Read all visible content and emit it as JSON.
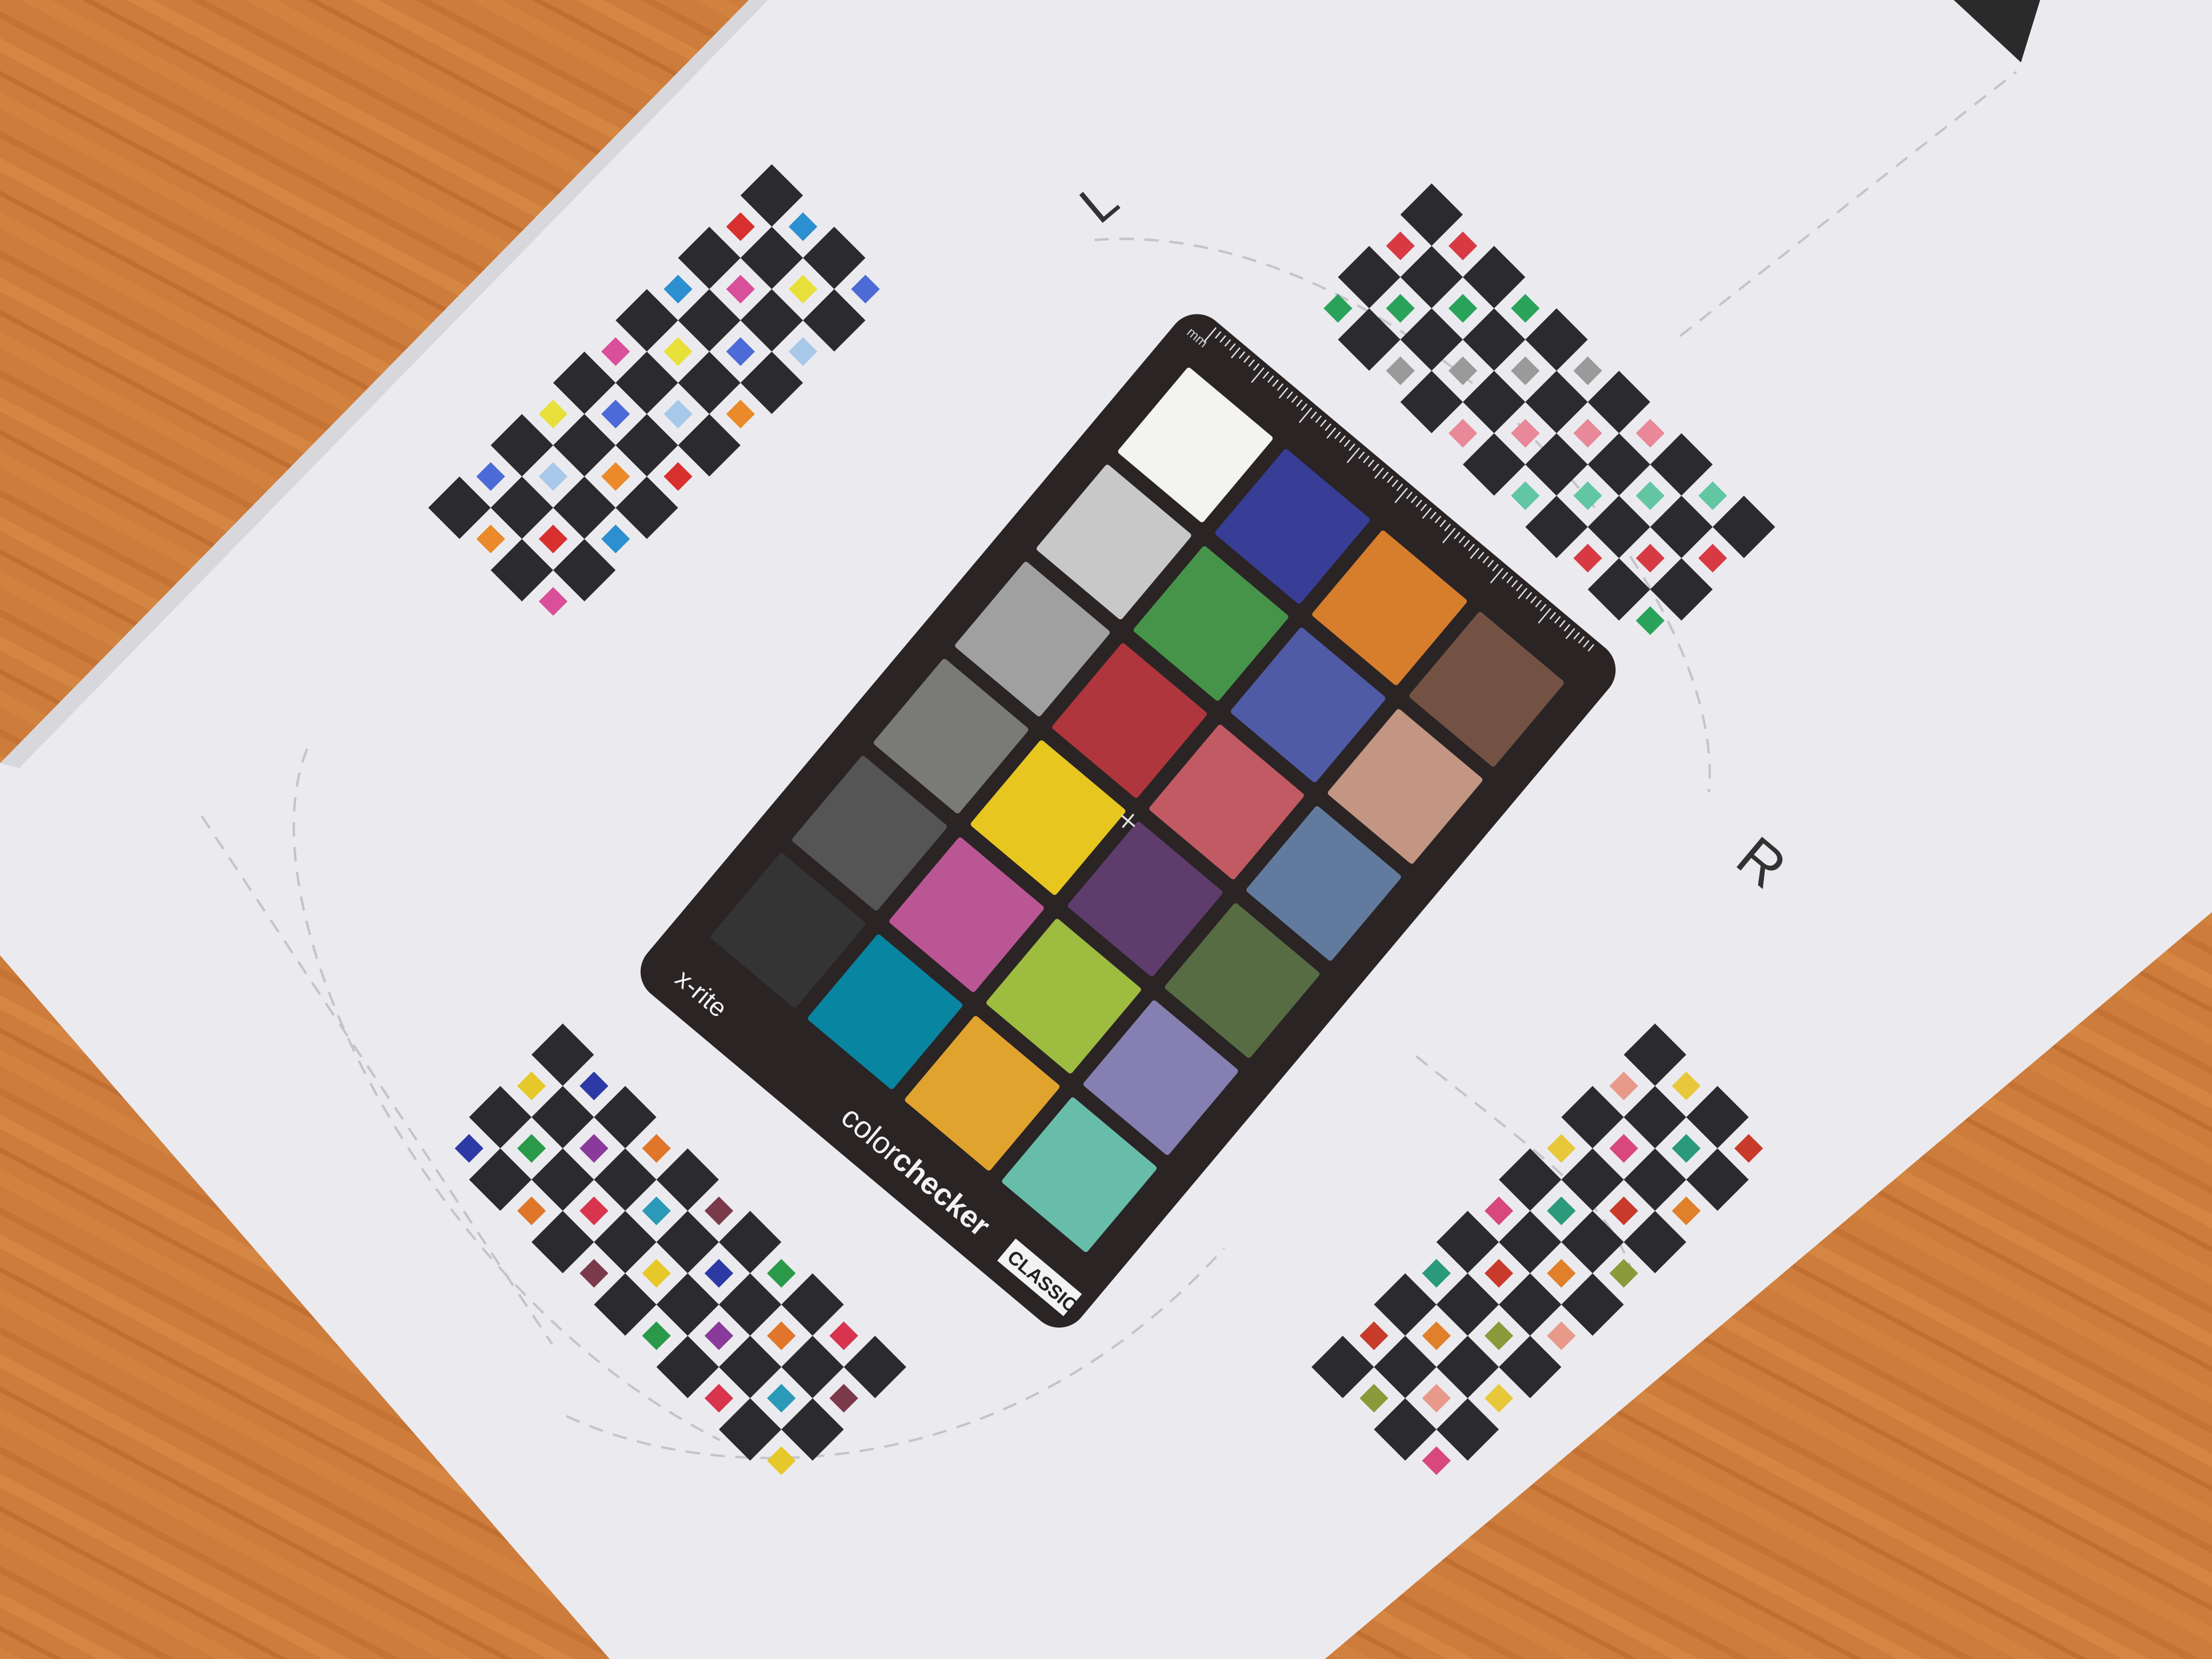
{
  "photo": {
    "subject": "x-rite colorchecker classic target on printed calibration sheet",
    "background_colors": {
      "wood": "#cf7f3d",
      "sheet": "#ececf0",
      "card": "#2a2425",
      "checker_dark": "#2b2b2d"
    }
  },
  "sheet_marks": {
    "left_mark": "L",
    "right_mark": "R"
  },
  "card": {
    "brand": "x-rite",
    "product_light": "color",
    "product_bold": "checker",
    "edition_badge": "CLASSIC",
    "ruler_unit": "mm",
    "patches": [
      [
        "#735244",
        "#c29682",
        "#627a9d",
        "#576c43",
        "#8580b1",
        "#67bdaa"
      ],
      [
        "#d67e2c",
        "#505ba6",
        "#c15a63",
        "#5e3c6c",
        "#9dbc40",
        "#e0a32e"
      ],
      [
        "#383d96",
        "#469449",
        "#af363c",
        "#e7c71f",
        "#bb5695",
        "#0885a1"
      ],
      [
        "#f3f3f2",
        "#c8c8c8",
        "#a0a0a0",
        "#7a7a79",
        "#555555",
        "#343434"
      ]
    ]
  },
  "checker_boards": {
    "top_left": {
      "accents": [
        "#4d6bd6",
        "#e8e03a",
        "#d94f9a",
        "#2c8fd0",
        "#d8302f",
        "#ea8a2a",
        "#a8c8ea"
      ]
    },
    "top_right": {
      "accents": [
        "#d83a44",
        "#2aa35a",
        "#9a9a9a",
        "#e88898",
        "#62c6a2"
      ]
    },
    "bottom_left": {
      "accents": [
        "#2d3aa6",
        "#e0762a",
        "#7a3a4a",
        "#2a9a4a",
        "#d8344e",
        "#e6c82a",
        "#8a3a9a",
        "#2a9ab8"
      ]
    },
    "bottom_right": {
      "accents": [
        "#c83a2a",
        "#2a9a7a",
        "#d8487a",
        "#e8c83a",
        "#e89a8a",
        "#8a9a3a",
        "#e0802a"
      ]
    }
  }
}
